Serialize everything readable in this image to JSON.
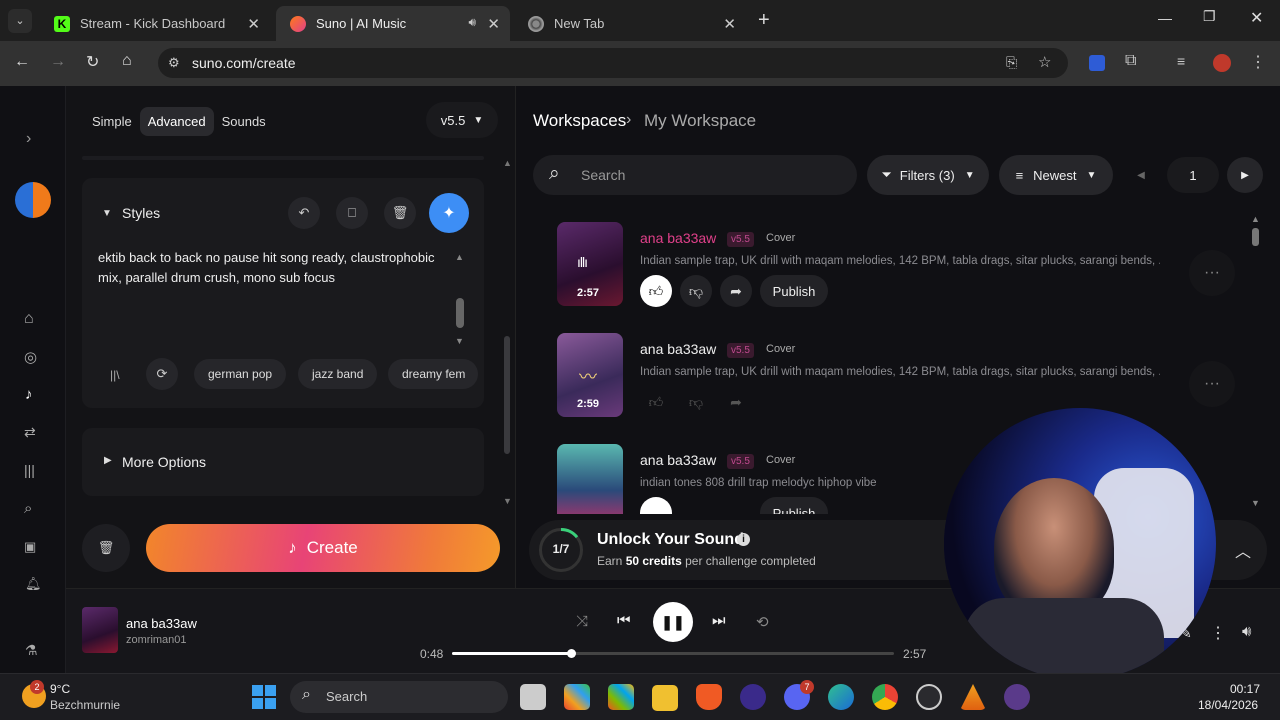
{
  "browser": {
    "tabs": [
      {
        "label": "Stream - Kick Dashboard",
        "active": false,
        "favicon_color": "#53fc18"
      },
      {
        "label": "Suno | AI Music",
        "active": true,
        "favicon_color": "#ff6b2b"
      },
      {
        "label": "New Tab",
        "active": false,
        "favicon_color": "#888888"
      }
    ],
    "url": "suno.com/create"
  },
  "create": {
    "modes": [
      "Simple",
      "Advanced",
      "Sounds"
    ],
    "selected_mode": "Advanced",
    "version": "v5.5",
    "styles_label": "Styles",
    "styles_text": "ektib back to back no pause hit song ready, claustrophobic mix, parallel drum crush, mono sub focus",
    "style_chips": [
      "german pop",
      "jazz band",
      "dreamy fem"
    ],
    "more_options": "More Options",
    "create_button": "Create"
  },
  "workspace": {
    "breadcrumb_root": "Workspaces",
    "breadcrumb_current": "My Workspace",
    "search_placeholder": "Search",
    "filters_label": "Filters (3)",
    "sort_label": "Newest",
    "page": "1",
    "songs": [
      {
        "title": "ana ba33aw",
        "version": "v5.5",
        "tag": "Cover",
        "duration": "2:57",
        "description": "Indian sample trap, UK drill with maqam melodies, 142 BPM, tabla drags, sitar plucks, sarangi bends, ...",
        "publish": "Publish",
        "playing": true
      },
      {
        "title": "ana ba33aw",
        "version": "v5.5",
        "tag": "Cover",
        "duration": "2:59",
        "description": "Indian sample trap, UK drill with maqam melodies, 142 BPM, tabla drags, sitar plucks, sarangi bends, ...",
        "publish": "",
        "playing": false
      },
      {
        "title": "ana ba33aw",
        "version": "v5.5",
        "tag": "Cover",
        "duration": "",
        "description": "indian tones 808 drill trap melodyc hiphop vibe",
        "publish": "Publish",
        "playing": false
      }
    ]
  },
  "challenge": {
    "progress": "1/7",
    "progress_fraction": 0.143,
    "title": "Unlock Your Sound",
    "subtitle_pre": "Earn",
    "credits": "50 credits",
    "subtitle_post": "per challenge completed"
  },
  "player": {
    "title": "ana ba33aw",
    "artist": "zomriman01",
    "elapsed": "0:48",
    "total": "2:57",
    "progress_fraction": 0.27
  },
  "taskbar": {
    "weather_temp": "9°C",
    "weather_loc": "Bezchmurnie",
    "weather_badge": "2",
    "search": "Search",
    "time": "00:17",
    "date": "18/04/2026",
    "discord_badge": "7"
  },
  "colors": {
    "accent_pink": "#e0408a",
    "create_gradient_start": "#f04a6a",
    "create_gradient_end": "#f59a2a",
    "wand_button": "#3d8ef5"
  }
}
